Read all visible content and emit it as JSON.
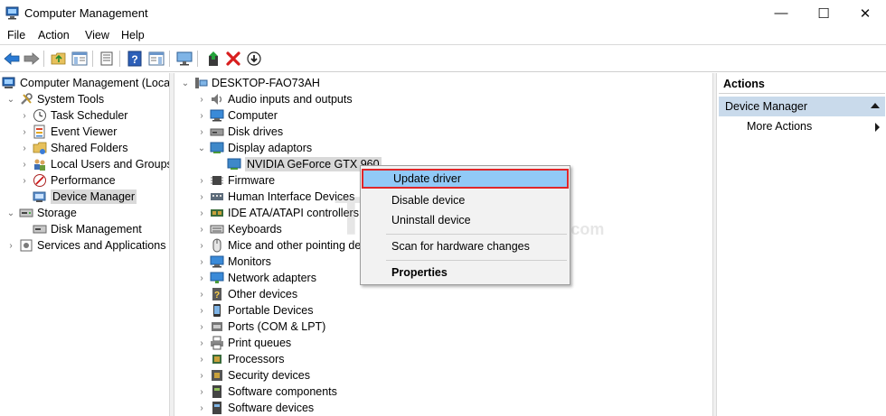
{
  "window": {
    "title": "Computer Management",
    "controls": [
      "—",
      "☐",
      "✕"
    ]
  },
  "menu": [
    "File",
    "Action",
    "View",
    "Help"
  ],
  "toolbar": {
    "icons": [
      "back-arrow-icon",
      "forward-arrow-icon",
      "up-folder-icon",
      "show-hide-tree-icon",
      "properties-icon",
      "help-icon",
      "action-pane-icon",
      "monitor-icon",
      "update-driver-icon",
      "uninstall-icon",
      "download-icon"
    ],
    "delete_color": "#d81e1e"
  },
  "left_tree": [
    {
      "label": "Computer Management (Local",
      "icon": "computer-management-icon",
      "caret": ""
    },
    {
      "label": "System Tools",
      "icon": "tools-icon",
      "caret": "v"
    },
    {
      "label": "Task Scheduler",
      "icon": "clock-icon",
      "caret": ">"
    },
    {
      "label": "Event Viewer",
      "icon": "event-viewer-icon",
      "caret": ">"
    },
    {
      "label": "Shared Folders",
      "icon": "shared-folder-icon",
      "caret": ">"
    },
    {
      "label": "Local Users and Groups",
      "icon": "users-icon",
      "caret": ">"
    },
    {
      "label": "Performance",
      "icon": "performance-icon",
      "caret": ">"
    },
    {
      "label": "Device Manager",
      "icon": "device-manager-icon",
      "caret": "",
      "selected": true
    },
    {
      "label": "Storage",
      "icon": "storage-icon",
      "caret": "v"
    },
    {
      "label": "Disk Management",
      "icon": "disk-management-icon",
      "caret": ""
    },
    {
      "label": "Services and Applications",
      "icon": "services-icon",
      "caret": ">"
    }
  ],
  "device_tree": {
    "root": "DESKTOP-FAO73AH",
    "items": [
      {
        "label": "Audio inputs and outputs",
        "icon": "speaker-icon",
        "caret": ">"
      },
      {
        "label": "Computer",
        "icon": "computer-icon",
        "caret": ">"
      },
      {
        "label": "Disk drives",
        "icon": "disk-drive-icon",
        "caret": ">"
      },
      {
        "label": "Display adaptors",
        "icon": "display-adapter-icon",
        "caret": "v"
      },
      {
        "label": "NVIDIA GeForce GTX 960",
        "icon": "gpu-icon",
        "caret": "",
        "child": true,
        "selected": true
      },
      {
        "label": "Firmware",
        "icon": "firmware-icon",
        "caret": ">"
      },
      {
        "label": "Human Interface Devices",
        "icon": "hid-icon",
        "caret": ">"
      },
      {
        "label": "IDE ATA/ATAPI controllers",
        "icon": "ide-controller-icon",
        "caret": ">"
      },
      {
        "label": "Keyboards",
        "icon": "keyboard-icon",
        "caret": ">"
      },
      {
        "label": "Mice and other pointing de",
        "icon": "mouse-icon",
        "caret": ">"
      },
      {
        "label": "Monitors",
        "icon": "monitor-icon",
        "caret": ">"
      },
      {
        "label": "Network adapters",
        "icon": "network-adapter-icon",
        "caret": ">"
      },
      {
        "label": "Other devices",
        "icon": "other-devices-icon",
        "caret": ">"
      },
      {
        "label": "Portable Devices",
        "icon": "portable-device-icon",
        "caret": ">"
      },
      {
        "label": "Ports (COM & LPT)",
        "icon": "port-icon",
        "caret": ">"
      },
      {
        "label": "Print queues",
        "icon": "printer-icon",
        "caret": ">"
      },
      {
        "label": "Processors",
        "icon": "processor-icon",
        "caret": ">"
      },
      {
        "label": "Security devices",
        "icon": "security-device-icon",
        "caret": ">"
      },
      {
        "label": "Software components",
        "icon": "software-component-icon",
        "caret": ">"
      },
      {
        "label": "Software devices",
        "icon": "software-device-icon",
        "caret": ">"
      }
    ]
  },
  "context_menu": {
    "items": [
      "Update driver",
      "Disable device",
      "Uninstall device",
      "Scan for hardware changes",
      "Properties"
    ],
    "highlight_color": "#91c9f7",
    "outline_color": "#e0262a"
  },
  "actions": {
    "header": "Actions",
    "section": "Device Manager",
    "more": "More Actions",
    "section_color": "#c9daeb"
  },
  "watermark": {
    "main": "TipsMake",
    "suffix": ".com"
  }
}
